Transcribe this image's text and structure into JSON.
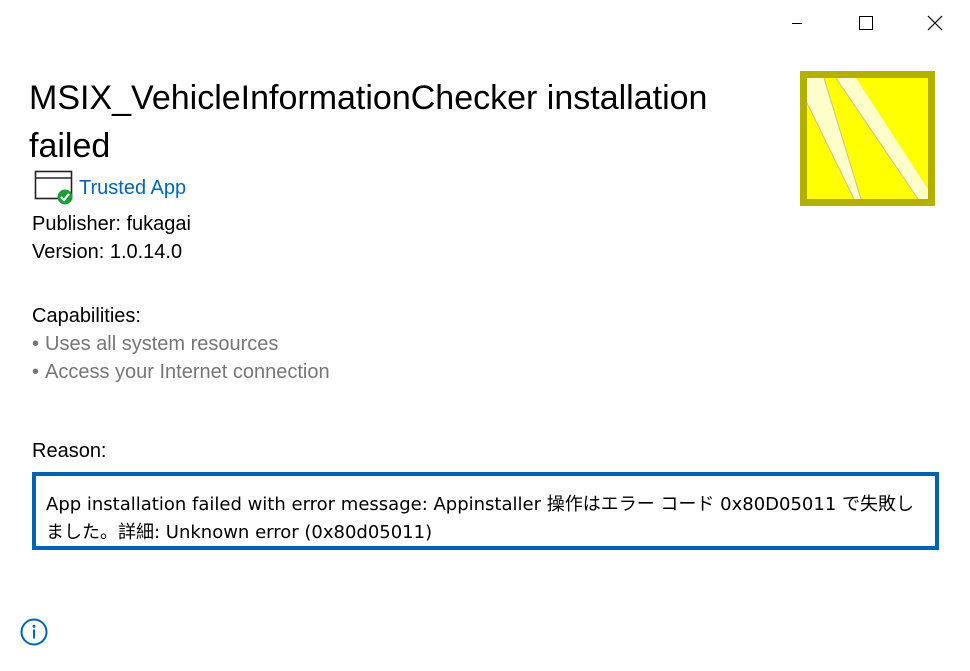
{
  "window": {
    "controls": {
      "minimize_icon": "minimize-icon",
      "maximize_icon": "maximize-icon",
      "close_icon": "close-icon"
    }
  },
  "app": {
    "title": "MSIX_VehicleInformationChecker installation failed",
    "trust_label": "Trusted App",
    "publisher": "Publisher: fukagai",
    "version": "Version: 1.0.14.0",
    "logo_icon": "app-logo-icon",
    "logo_colors": {
      "border": "#b4b000",
      "fill": "#ffff00",
      "stripe": "#ffffcc"
    }
  },
  "capabilities": {
    "heading": "Capabilities:",
    "items": [
      "Uses all system resources",
      "Access your Internet connection"
    ]
  },
  "reason": {
    "heading": "Reason:",
    "message": "App installation failed with error message: Appinstaller 操作はエラー コード 0x80D05011 で失敗しました。詳細: Unknown error (0x80d05011)"
  },
  "footer": {
    "info_icon": "info-icon"
  },
  "colors": {
    "accent": "#0067b8",
    "error_border": "#0063b1",
    "muted_text": "#767676",
    "check_badge": "#16a035"
  }
}
